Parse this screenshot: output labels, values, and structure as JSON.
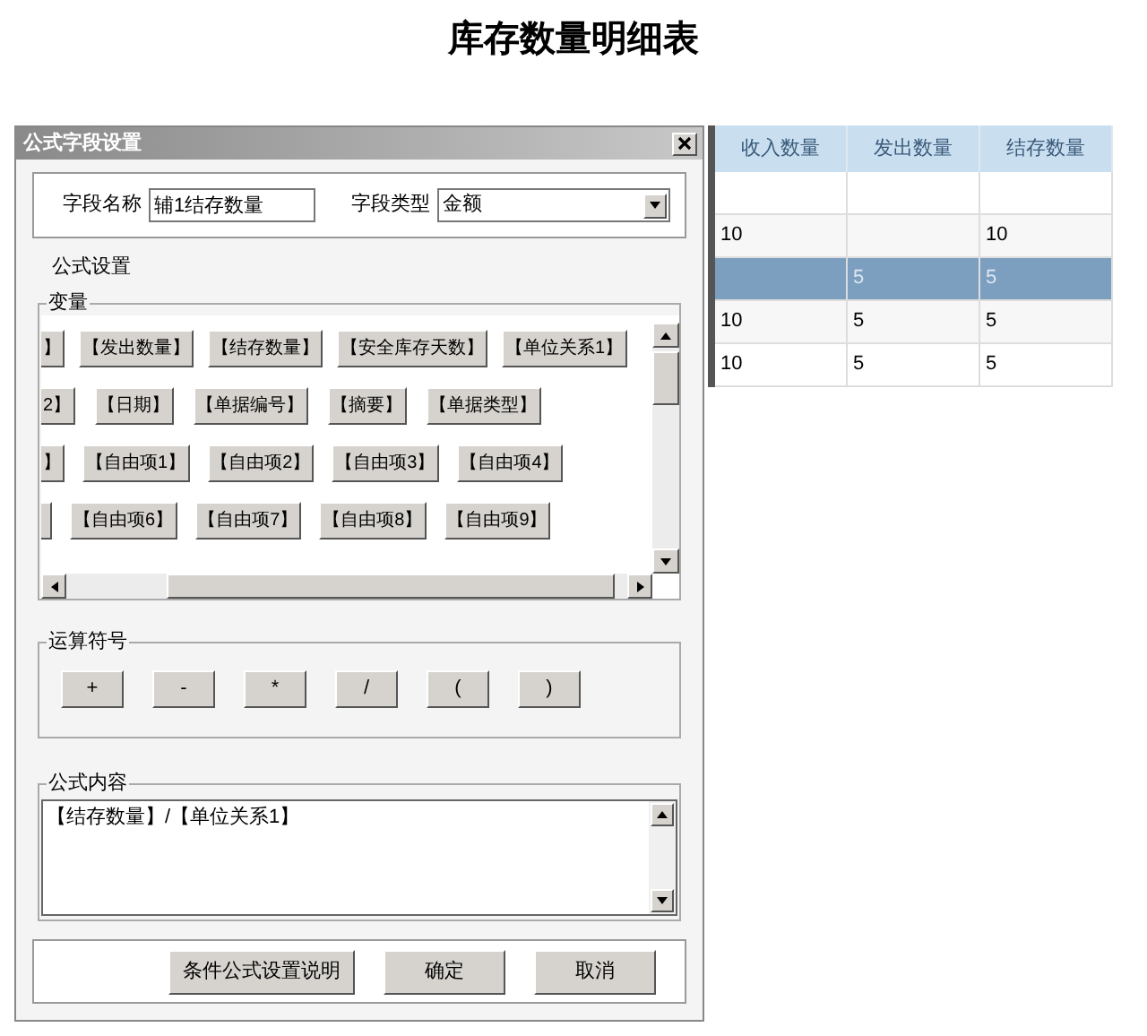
{
  "page_title": "库存数量明细表",
  "table": {
    "columns": [
      "收入数量",
      "发出数量",
      "结存数量"
    ],
    "rows": [
      {
        "selected": false,
        "cells": [
          null,
          null,
          null
        ]
      },
      {
        "selected": false,
        "cells": [
          "10",
          null,
          "10"
        ]
      },
      {
        "selected": true,
        "cells": [
          null,
          "5",
          "5"
        ]
      },
      {
        "selected": false,
        "cells": [
          "10",
          "5",
          "5"
        ]
      },
      {
        "selected": false,
        "cells": [
          "10",
          "5",
          "5"
        ]
      }
    ]
  },
  "dialog": {
    "title": "公式字段设置",
    "field_name": {
      "label": "字段名称",
      "value": "辅1结存数量"
    },
    "field_type": {
      "label": "字段类型",
      "value": "金额"
    },
    "formula_settings_label": "公式设置",
    "variables": {
      "legend": "变量",
      "rows": [
        [
          {
            "kind": "button",
            "label": "】"
          },
          {
            "kind": "button",
            "label": "【发出数量】"
          },
          {
            "kind": "button",
            "label": "【结存数量】"
          },
          {
            "kind": "button",
            "label": "【安全库存天数】"
          },
          {
            "kind": "button",
            "label": "【单位关系1】"
          }
        ],
        [
          {
            "kind": "button",
            "label": "2】"
          },
          {
            "kind": "button",
            "label": "【日期】"
          },
          {
            "kind": "button",
            "label": "【单据编号】"
          },
          {
            "kind": "button",
            "label": "【摘要】"
          },
          {
            "kind": "button",
            "label": "【单据类型】"
          }
        ],
        [
          {
            "kind": "button",
            "label": "】"
          },
          {
            "kind": "button",
            "label": "【自由项1】"
          },
          {
            "kind": "button",
            "label": "【自由项2】"
          },
          {
            "kind": "button",
            "label": "【自由项3】"
          },
          {
            "kind": "button",
            "label": "【自由项4】"
          }
        ],
        [
          {
            "kind": "clipped"
          },
          {
            "kind": "button",
            "label": "【自由项6】"
          },
          {
            "kind": "button",
            "label": "【自由项7】"
          },
          {
            "kind": "button",
            "label": "【自由项8】"
          },
          {
            "kind": "button",
            "label": "【自由项9】"
          }
        ]
      ]
    },
    "operators": {
      "legend": "运算符号",
      "buttons": [
        "+",
        "-",
        "*",
        "/",
        "(",
        ")"
      ]
    },
    "formula": {
      "legend": "公式内容",
      "value": "【结存数量】/【单位关系1】"
    },
    "buttons": [
      "条件公式设置说明",
      "确定",
      "取消"
    ]
  }
}
